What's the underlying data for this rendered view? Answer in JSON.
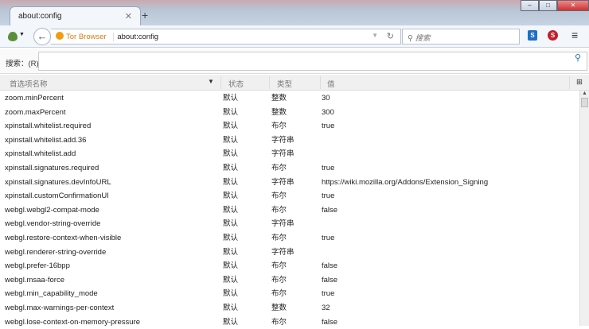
{
  "window": {
    "tab_title": "about:config",
    "close": "✕",
    "new_tab": "+",
    "min": "–",
    "max": "□",
    "close_win": "✕"
  },
  "nav": {
    "identity": "Tor Browser",
    "url": "about:config",
    "search_placeholder": "搜索",
    "ext1": "S",
    "ext2": "S"
  },
  "filter": {
    "label": "搜索：(R)",
    "value": ""
  },
  "columns": {
    "name": "首选项名称",
    "status": "状态",
    "type": "类型",
    "value": "值"
  },
  "rows": [
    {
      "name": "zoom.minPercent",
      "status": "默认",
      "type": "整数",
      "value": "30"
    },
    {
      "name": "zoom.maxPercent",
      "status": "默认",
      "type": "整数",
      "value": "300"
    },
    {
      "name": "xpinstall.whitelist.required",
      "status": "默认",
      "type": "布尔",
      "value": "true"
    },
    {
      "name": "xpinstall.whitelist.add.36",
      "status": "默认",
      "type": "字符串",
      "value": ""
    },
    {
      "name": "xpinstall.whitelist.add",
      "status": "默认",
      "type": "字符串",
      "value": ""
    },
    {
      "name": "xpinstall.signatures.required",
      "status": "默认",
      "type": "布尔",
      "value": "true"
    },
    {
      "name": "xpinstall.signatures.devInfoURL",
      "status": "默认",
      "type": "字符串",
      "value": "https://wiki.mozilla.org/Addons/Extension_Signing"
    },
    {
      "name": "xpinstall.customConfirmationUI",
      "status": "默认",
      "type": "布尔",
      "value": "true"
    },
    {
      "name": "webgl.webgl2-compat-mode",
      "status": "默认",
      "type": "布尔",
      "value": "false"
    },
    {
      "name": "webgl.vendor-string-override",
      "status": "默认",
      "type": "字符串",
      "value": ""
    },
    {
      "name": "webgl.restore-context-when-visible",
      "status": "默认",
      "type": "布尔",
      "value": "true"
    },
    {
      "name": "webgl.renderer-string-override",
      "status": "默认",
      "type": "字符串",
      "value": ""
    },
    {
      "name": "webgl.prefer-16bpp",
      "status": "默认",
      "type": "布尔",
      "value": "false"
    },
    {
      "name": "webgl.msaa-force",
      "status": "默认",
      "type": "布尔",
      "value": "false"
    },
    {
      "name": "webgl.min_capability_mode",
      "status": "默认",
      "type": "布尔",
      "value": "true"
    },
    {
      "name": "webgl.max-warnings-per-context",
      "status": "默认",
      "type": "整数",
      "value": "32"
    },
    {
      "name": "webgl.lose-context-on-memory-pressure",
      "status": "默认",
      "type": "布尔",
      "value": "false"
    }
  ]
}
